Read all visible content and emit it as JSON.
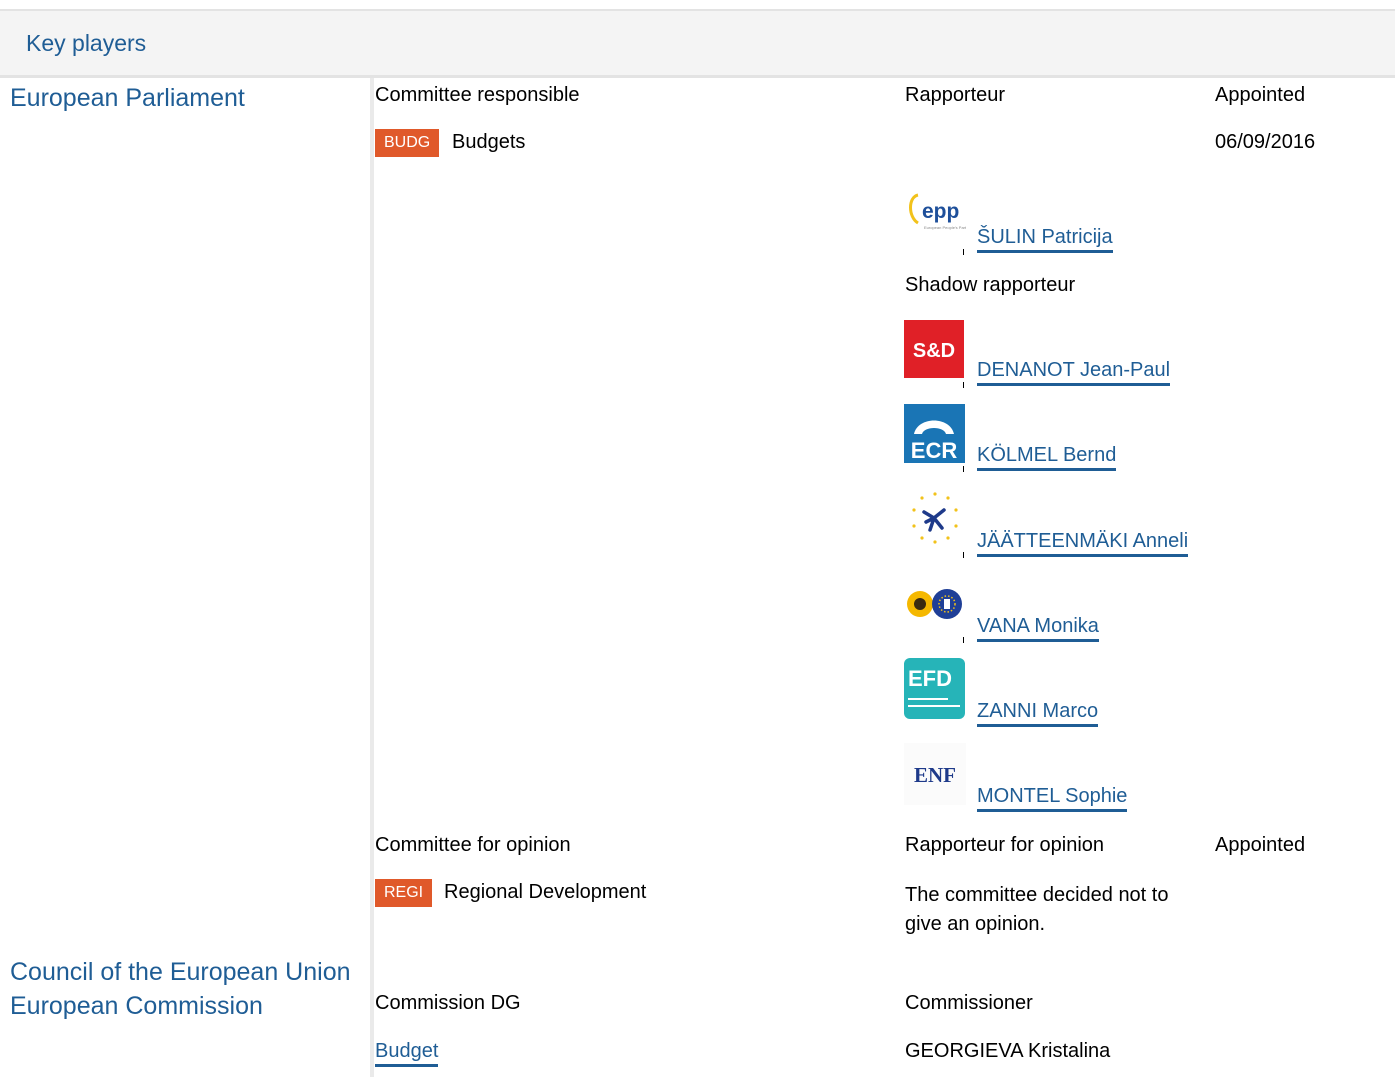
{
  "header": {
    "title": "Key players"
  },
  "institutions": {
    "ep": "European Parliament",
    "council": "Council of the European Union",
    "commission": "European Commission"
  },
  "ep": {
    "col_committee": "Committee responsible",
    "col_rapporteur": "Rapporteur",
    "col_appointed": "Appointed",
    "committee_code": "BUDG",
    "committee_name": "Budgets",
    "appointed_date": "06/09/2016",
    "rapporteur": {
      "name": "ŠULIN Patricija",
      "group_logo": "epp-logo"
    },
    "shadow_label": "Shadow rapporteur",
    "shadows": [
      {
        "name": "DENANOT Jean-Paul",
        "group_logo": "sd-logo",
        "logo_text": "S&D"
      },
      {
        "name": "KÖLMEL Bernd",
        "group_logo": "ecr-logo",
        "logo_text": "ECR"
      },
      {
        "name": "JÄÄTTEENMÄKI Anneli",
        "group_logo": "alde-logo"
      },
      {
        "name": "VANA Monika",
        "group_logo": "greens-efa-logo"
      },
      {
        "name": "ZANNI Marco",
        "group_logo": "efdd-logo",
        "logo_text": "EFD"
      },
      {
        "name": "MONTEL Sophie",
        "group_logo": "enf-logo",
        "logo_text": "ENF"
      }
    ],
    "opinion_col_committee": "Committee for opinion",
    "opinion_col_rapporteur": "Rapporteur for opinion",
    "opinion_col_appointed": "Appointed",
    "opinion_committee_code": "REGI",
    "opinion_committee_name": "Regional Development",
    "opinion_note": "The committee decided not to give an opinion."
  },
  "commission": {
    "col_dg": "Commission DG",
    "col_commissioner": "Commissioner",
    "dg": "Budget",
    "commissioner": "GEORGIEVA Kristalina"
  },
  "colors": {
    "link": "#1f5d95",
    "badge": "#e0592a",
    "header_bg": "#f4f4f4"
  }
}
